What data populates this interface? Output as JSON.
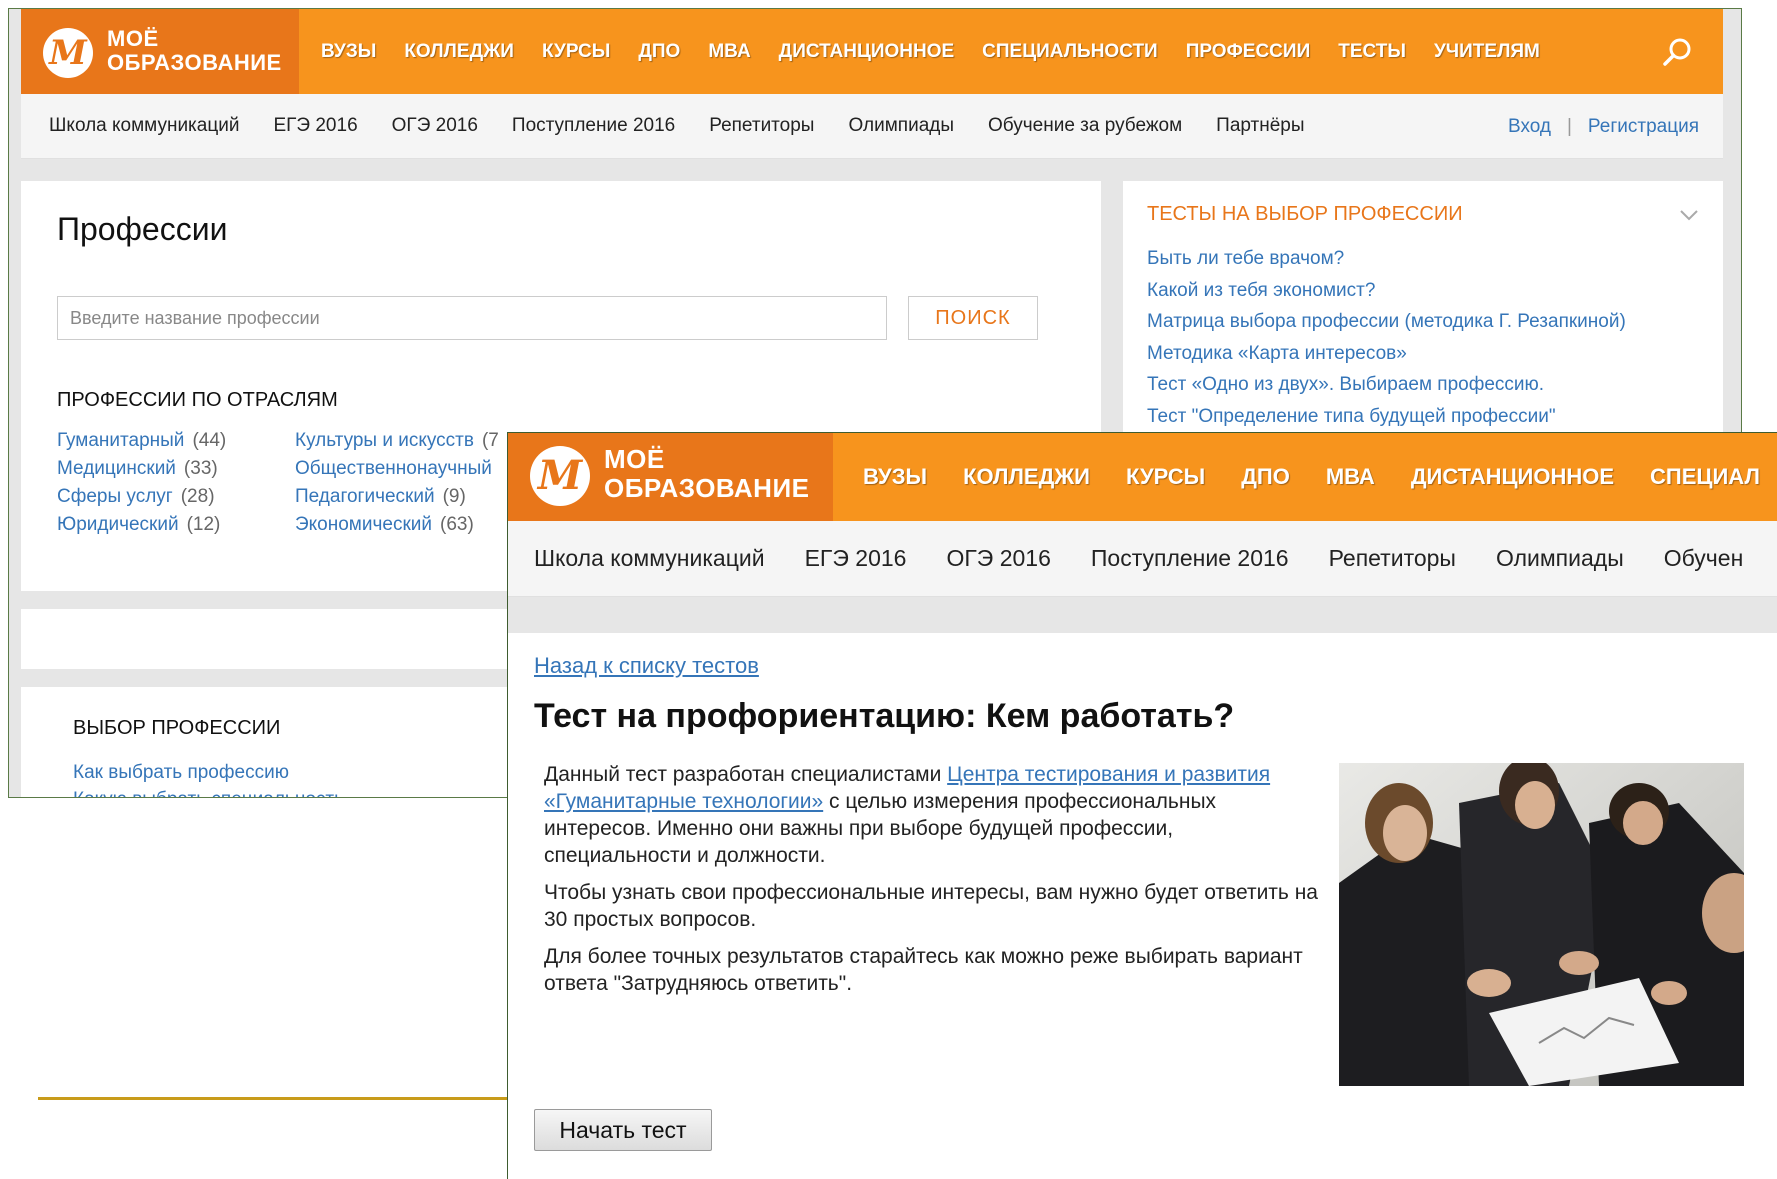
{
  "brand": {
    "logo_letter": "M",
    "line1": "МОЁ",
    "line2": "ОБРАЗОВАНИЕ",
    "orange": "#f7941d",
    "dark_orange": "#e8761a",
    "link_blue": "#3575b8"
  },
  "back_window": {
    "nav": [
      "ВУЗЫ",
      "КОЛЛЕДЖИ",
      "КУРСЫ",
      "ДПО",
      "МВА",
      "ДИСТАНЦИОННОЕ",
      "СПЕЦИАЛЬНОСТИ",
      "ПРОФЕССИИ",
      "ТЕСТЫ",
      "УЧИТЕЛЯМ"
    ],
    "subnav": [
      "Школа коммуникаций",
      "ЕГЭ 2016",
      "ОГЭ 2016",
      "Поступление 2016",
      "Репетиторы",
      "Олимпиады",
      "Обучение за рубежом",
      "Партнёры"
    ],
    "login": "Вход",
    "auth_sep": "|",
    "register": "Регистрация",
    "page_title": "Профессии",
    "search_placeholder": "Введите название профессии",
    "search_button": "ПОИСК",
    "industries_title": "ПРОФЕССИИ ПО ОТРАСЛЯМ",
    "industries_col1": [
      {
        "name": "Гуманитарный",
        "count": "(44)"
      },
      {
        "name": "Медицинский",
        "count": "(33)"
      },
      {
        "name": "Сферы услуг",
        "count": "(28)"
      },
      {
        "name": "Юридический",
        "count": "(12)"
      }
    ],
    "industries_col2": [
      {
        "name": "Культуры и искусств",
        "count": "(7"
      },
      {
        "name": "Общественнонаучный",
        "count": ""
      },
      {
        "name": "Педагогический",
        "count": "(9)"
      },
      {
        "name": "Экономический",
        "count": "(63)"
      }
    ],
    "choice_title": "ВЫБОР ПРОФЕССИИ",
    "choice_links": [
      "Как выбрать профессию",
      "Какую выбрать специальность"
    ],
    "side_title": "ТЕСТЫ НА ВЫБОР ПРОФЕССИИ",
    "side_links": [
      "Быть ли тебе врачом?",
      "Какой из тебя экономист?",
      "Матрица выбора профессии (методика Г. Резапкиной)",
      "Методика «Карта интересов»",
      "Тест «Одно из двух». Выбираем профессию.",
      "Тест \"Определение типа будущей профессии\""
    ]
  },
  "front_window": {
    "nav": [
      "ВУЗЫ",
      "КОЛЛЕДЖИ",
      "КУРСЫ",
      "ДПО",
      "МВА",
      "ДИСТАНЦИОННОЕ",
      "СПЕЦИАЛ"
    ],
    "subnav": [
      "Школа коммуникаций",
      "ЕГЭ 2016",
      "ОГЭ 2016",
      "Поступление 2016",
      "Репетиторы",
      "Олимпиады",
      "Обучен"
    ],
    "back_link": "Назад к списку тестов",
    "title": "Тест на профориентацию: Кем работать?",
    "p1_before": "Данный тест разработан специалистами ",
    "p1_link": "Центра тестирования и развития «Гуманитарные технологии»",
    "p1_after": " с целью измерения профессиональных интересов. Именно они важны при выборе будущей профессии, специальности и должности.",
    "p2": "Чтобы узнать свои профессиональные интересы, вам нужно будет ответить на 30 простых вопросов.",
    "p3": "Для более точных результатов старайтесь как можно реже выбирать вариант ответа \"Затрудняюсь ответить\".",
    "start_button": "Начать тест"
  }
}
